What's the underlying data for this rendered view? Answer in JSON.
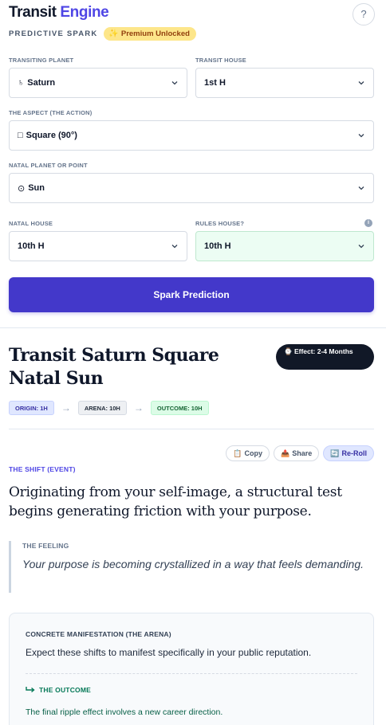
{
  "header": {
    "title_main": "Transit",
    "title_accent": "Engine",
    "help_label": "?",
    "subtitle": "PREDICTIVE SPARK",
    "premium_icon": "sparkle-icon",
    "premium_label": "Premium Unlocked"
  },
  "form": {
    "transiting_planet": {
      "label": "TRANSITING PLANET",
      "glyph": "♄",
      "value": "Saturn"
    },
    "transit_house": {
      "label": "TRANSIT HOUSE",
      "value": "1st H"
    },
    "aspect": {
      "label": "THE ASPECT (THE ACTION)",
      "glyph": "□",
      "value": "Square (90°)"
    },
    "natal_point": {
      "label": "NATAL PLANET OR POINT",
      "glyph": "⊙",
      "value": "Sun"
    },
    "natal_house": {
      "label": "NATAL HOUSE",
      "value": "10th H"
    },
    "rules_house": {
      "label": "RULES HOUSE?",
      "value": "10th H",
      "info_icon": "info-icon",
      "highlight_color": "#ecfdf3"
    },
    "submit_label": "Spark Prediction",
    "accent_color": "#4338ca"
  },
  "result": {
    "title": "Transit Saturn Square Natal Sun",
    "effect_badge": "⌚ Effect: 2-4 Months",
    "flow": {
      "origin": "ORIGIN: 1H",
      "arena": "ARENA: 10H",
      "outcome": "OUTCOME: 10H"
    },
    "actions": {
      "copy": "Copy",
      "copy_icon": "clipboard-icon",
      "share": "Share",
      "share_icon": "share-icon",
      "reroll": "Re-Roll",
      "reroll_icon": "reroll-icon"
    },
    "shift_label": "THE SHIFT (EVENT)",
    "shift_text": "Originating from your self-image, a structural test begins generating friction with your purpose.",
    "feeling_label": "THE FEELING",
    "feeling_text": "Your purpose is becoming crystallized in a way that feels demanding.",
    "manifest_label": "CONCRETE MANIFESTATION (THE ARENA)",
    "manifest_text": "Expect these shifts to manifest specifically in your public reputation.",
    "outcome_label": "THE OUTCOME",
    "outcome_icon": "return-arrow-icon",
    "outcome_text": "The final ripple effect involves a new career direction."
  }
}
